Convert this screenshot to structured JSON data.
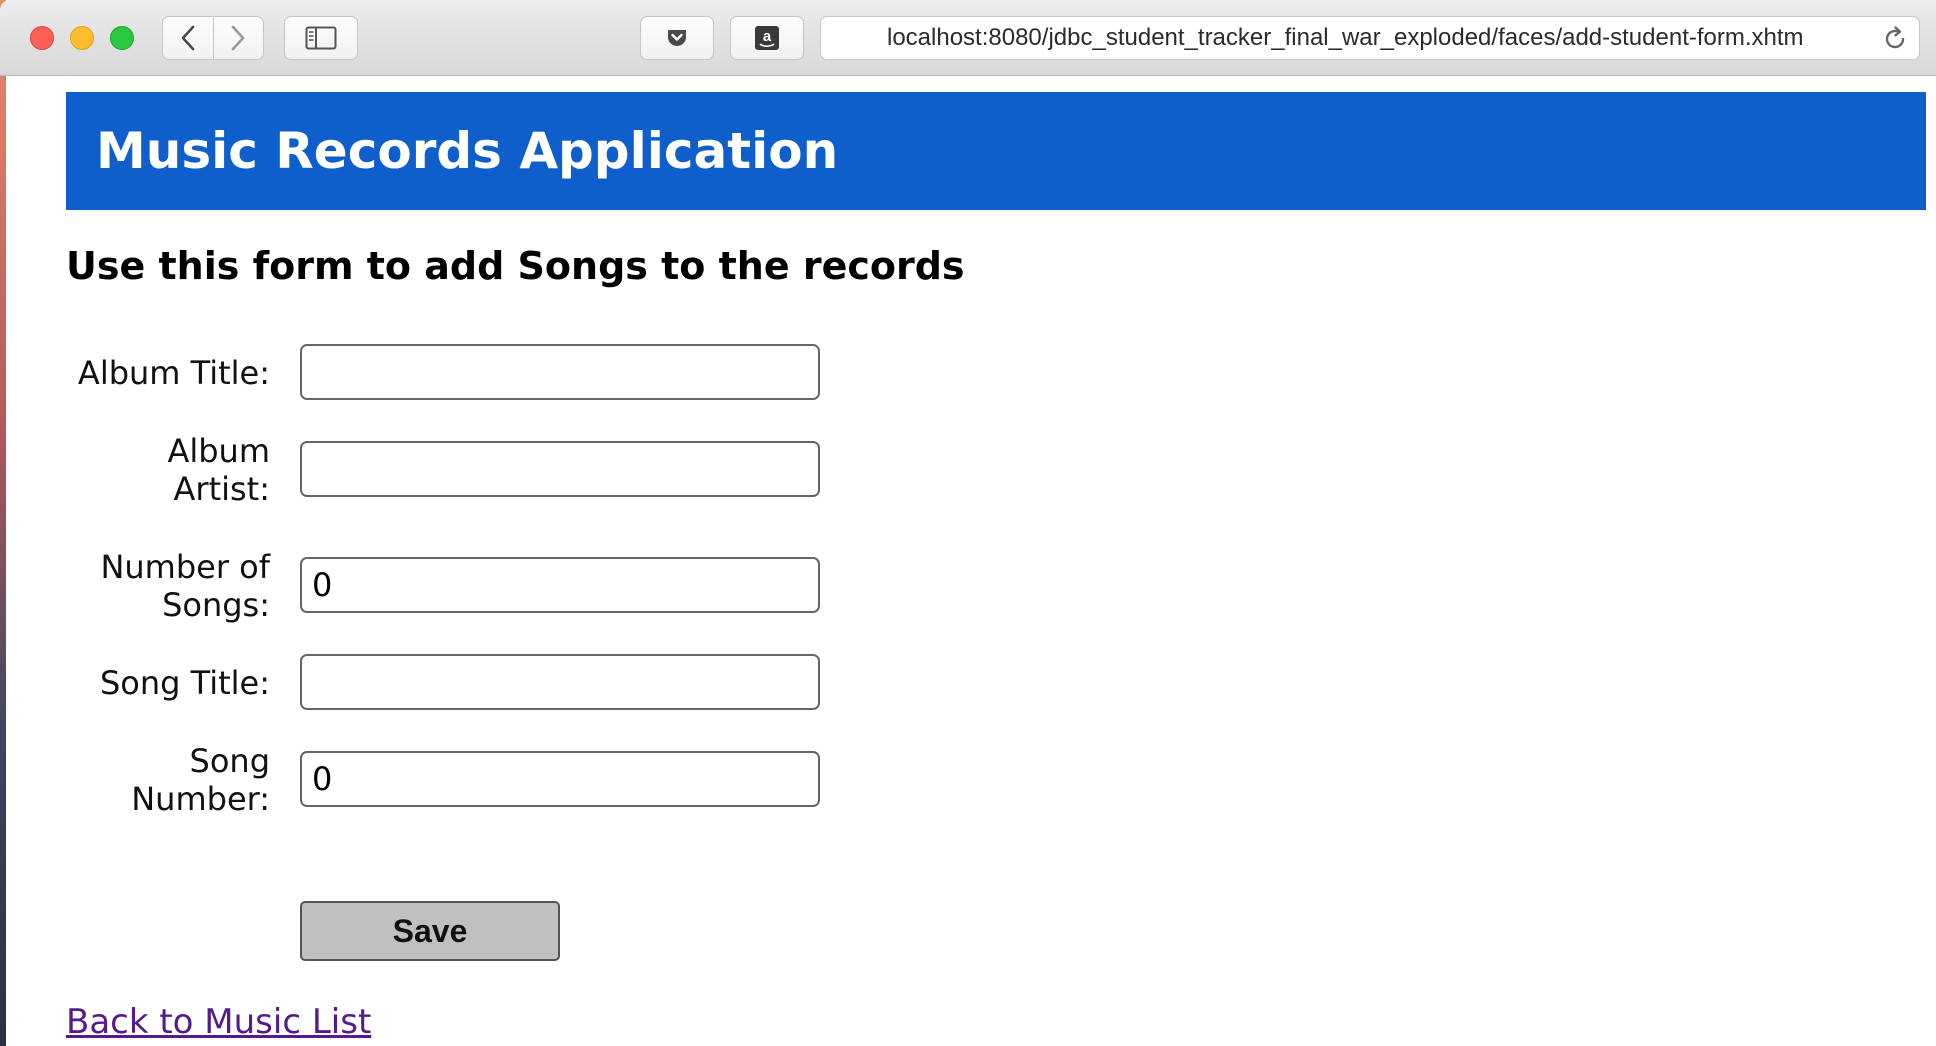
{
  "browser": {
    "url": "localhost:8080/jdbc_student_tracker_final_war_exploded/faces/add-student-form.xhtm",
    "toolbar_icons": [
      "chevron-left-icon",
      "chevron-right-icon",
      "sidebar-icon",
      "pocket-icon",
      "amazon-icon",
      "reload-icon"
    ]
  },
  "page": {
    "header_title": "Music Records Application",
    "form_heading": "Use this form to add Songs to the records",
    "header_color": "#0e5fcb",
    "fields": [
      {
        "label_line1": "Album Title:",
        "label_line2": "",
        "value": ""
      },
      {
        "label_line1": "Album",
        "label_line2": "Artist:",
        "value": ""
      },
      {
        "label_line1": "Number of",
        "label_line2": "Songs:",
        "value": "0"
      },
      {
        "label_line1": "Song Title:",
        "label_line2": "",
        "value": ""
      },
      {
        "label_line1": "Song",
        "label_line2": "Number:",
        "value": "0"
      }
    ],
    "save_label": "Save",
    "back_link": "Back to Music List"
  }
}
